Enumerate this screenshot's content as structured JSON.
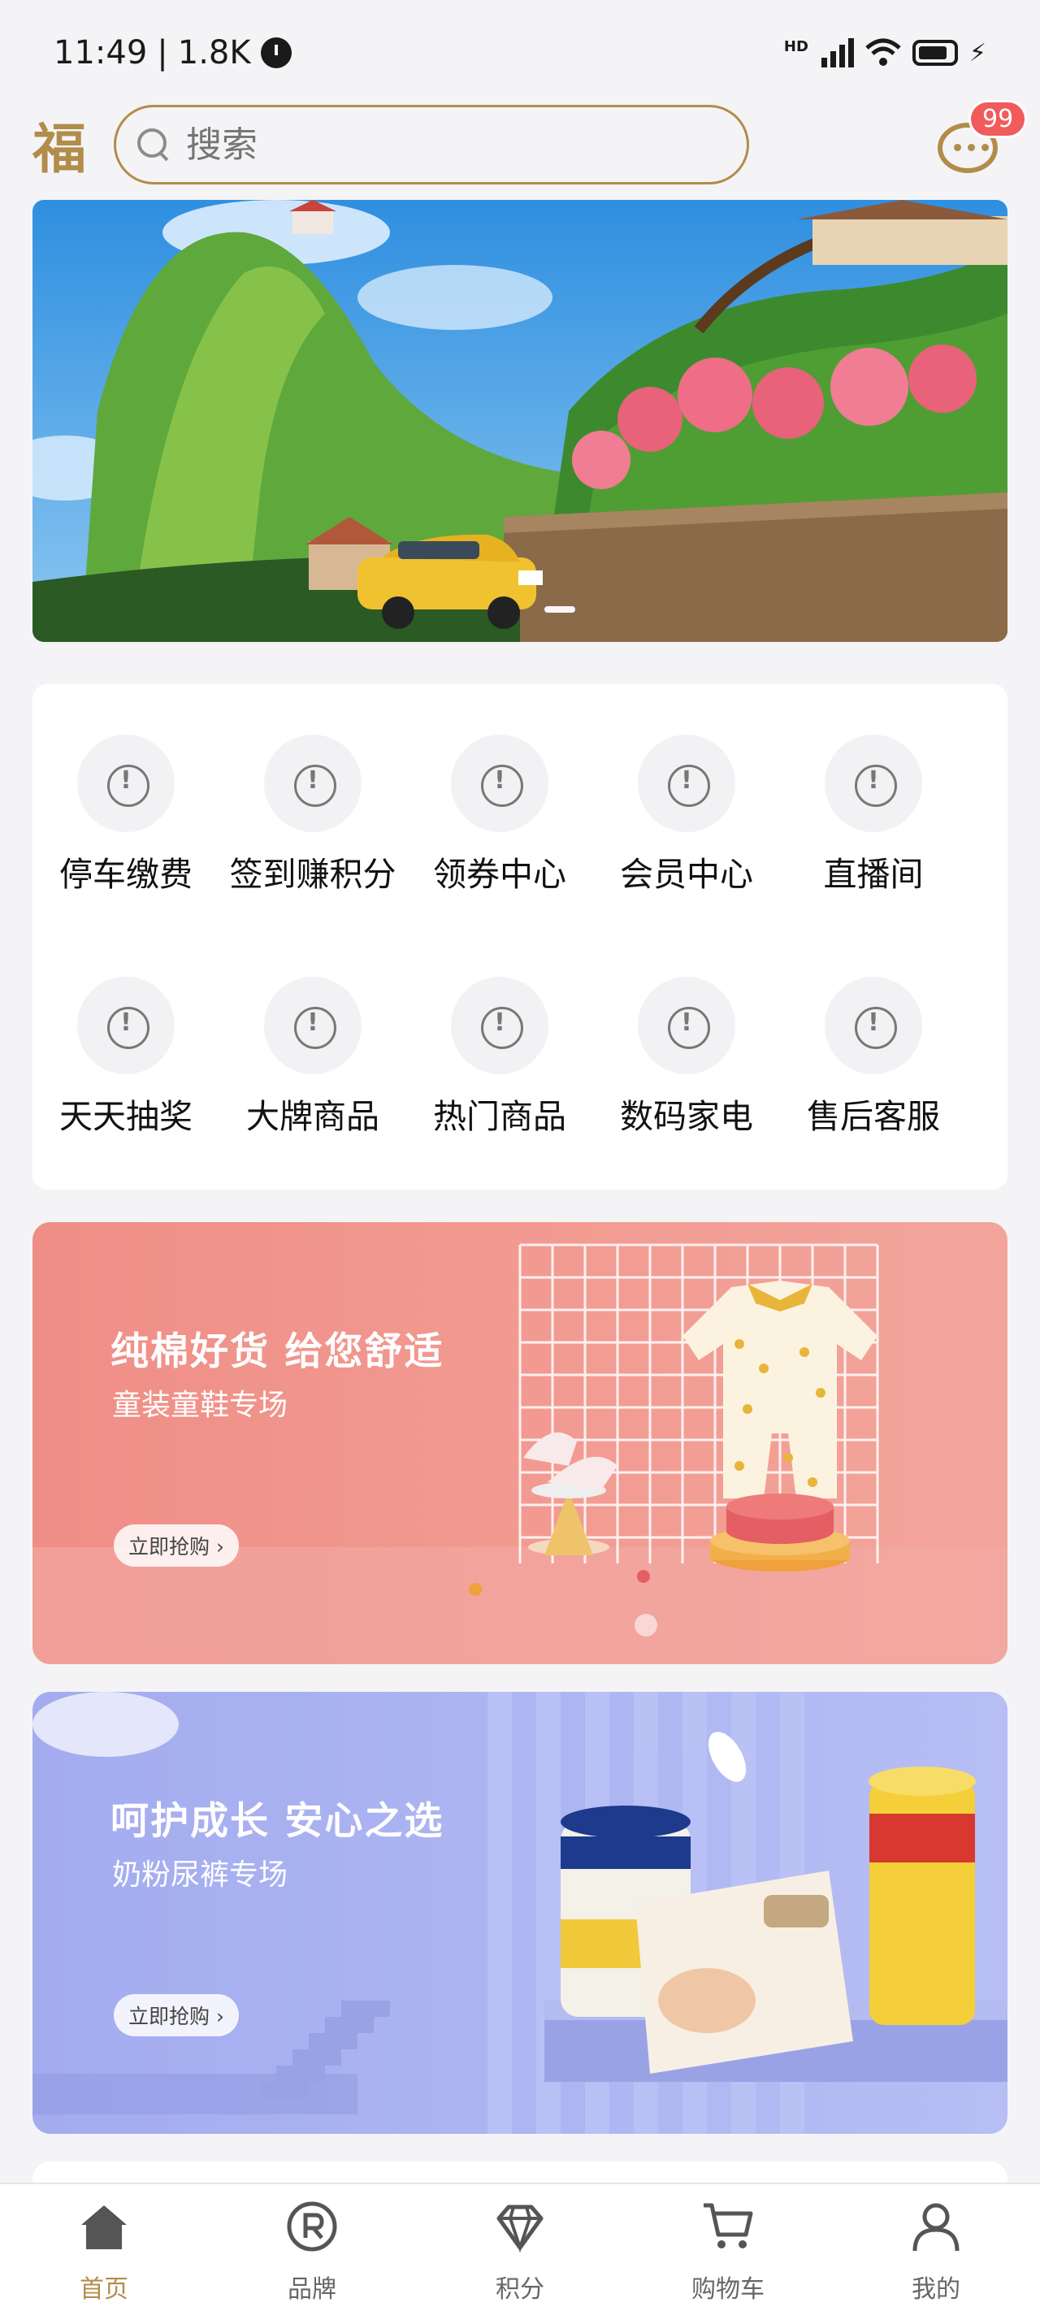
{
  "status_bar": {
    "time": "11:49",
    "separator": "|",
    "net_speed": "1.8K",
    "hd": "HD"
  },
  "header": {
    "logo": "福",
    "search_placeholder": "搜索",
    "message_badge": "99"
  },
  "banner": {
    "active_index": 0
  },
  "menu": {
    "items": [
      {
        "label": "停车缴费",
        "icon": "alert-circle-icon"
      },
      {
        "label": "签到赚积分",
        "icon": "alert-circle-icon"
      },
      {
        "label": "领券中心",
        "icon": "alert-circle-icon"
      },
      {
        "label": "会员中心",
        "icon": "alert-circle-icon"
      },
      {
        "label": "直播间",
        "icon": "alert-circle-icon"
      },
      {
        "label": "天天抽奖",
        "icon": "alert-circle-icon"
      },
      {
        "label": "大牌商品",
        "icon": "alert-circle-icon"
      },
      {
        "label": "热门商品",
        "icon": "alert-circle-icon"
      },
      {
        "label": "数码家电",
        "icon": "alert-circle-icon"
      },
      {
        "label": "售后客服",
        "icon": "alert-circle-icon"
      }
    ]
  },
  "promos": [
    {
      "title": "纯棉好货 给您舒适",
      "subtitle": "童装童鞋专场",
      "button": "立即抢购 ›",
      "color": "#ef8e86"
    },
    {
      "title": "呵护成长 安心之选",
      "subtitle": "奶粉尿裤专场",
      "button": "立即抢购 ›",
      "color": "#a3acef"
    }
  ],
  "tabbar": {
    "active_color": "#b28c4a",
    "tabs": [
      {
        "label": "首页",
        "icon": "home-icon"
      },
      {
        "label": "品牌",
        "icon": "brand-icon"
      },
      {
        "label": "积分",
        "icon": "diamond-icon"
      },
      {
        "label": "购物车",
        "icon": "cart-icon"
      },
      {
        "label": "我的",
        "icon": "user-icon"
      }
    ]
  }
}
